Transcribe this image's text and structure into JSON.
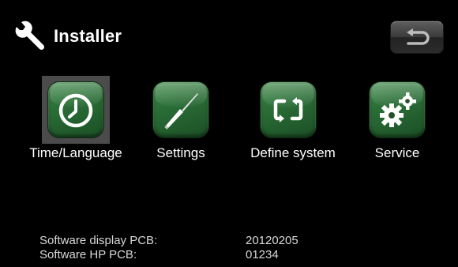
{
  "header": {
    "title": "Installer",
    "title_icon": "wrench-icon",
    "back_icon": "back-arrow-icon"
  },
  "menu": {
    "items": [
      {
        "label": "Time/Language",
        "icon": "clock-icon",
        "selected": true
      },
      {
        "label": "Settings",
        "icon": "screwdriver-icon",
        "selected": false
      },
      {
        "label": "Define system",
        "icon": "cycle-arrows-icon",
        "selected": false
      },
      {
        "label": "Service",
        "icon": "gears-icon",
        "selected": false
      }
    ]
  },
  "info": {
    "rows": [
      {
        "label": "Software display PCB:",
        "value": "20120205"
      },
      {
        "label": "Software HP PCB:",
        "value": "01234"
      }
    ]
  },
  "colors": {
    "background": "#000000",
    "tile_green": "#2a6d36",
    "selected_frame": "#4b4b4b",
    "text": "#ffffff",
    "info_text": "#d8d8d8"
  }
}
